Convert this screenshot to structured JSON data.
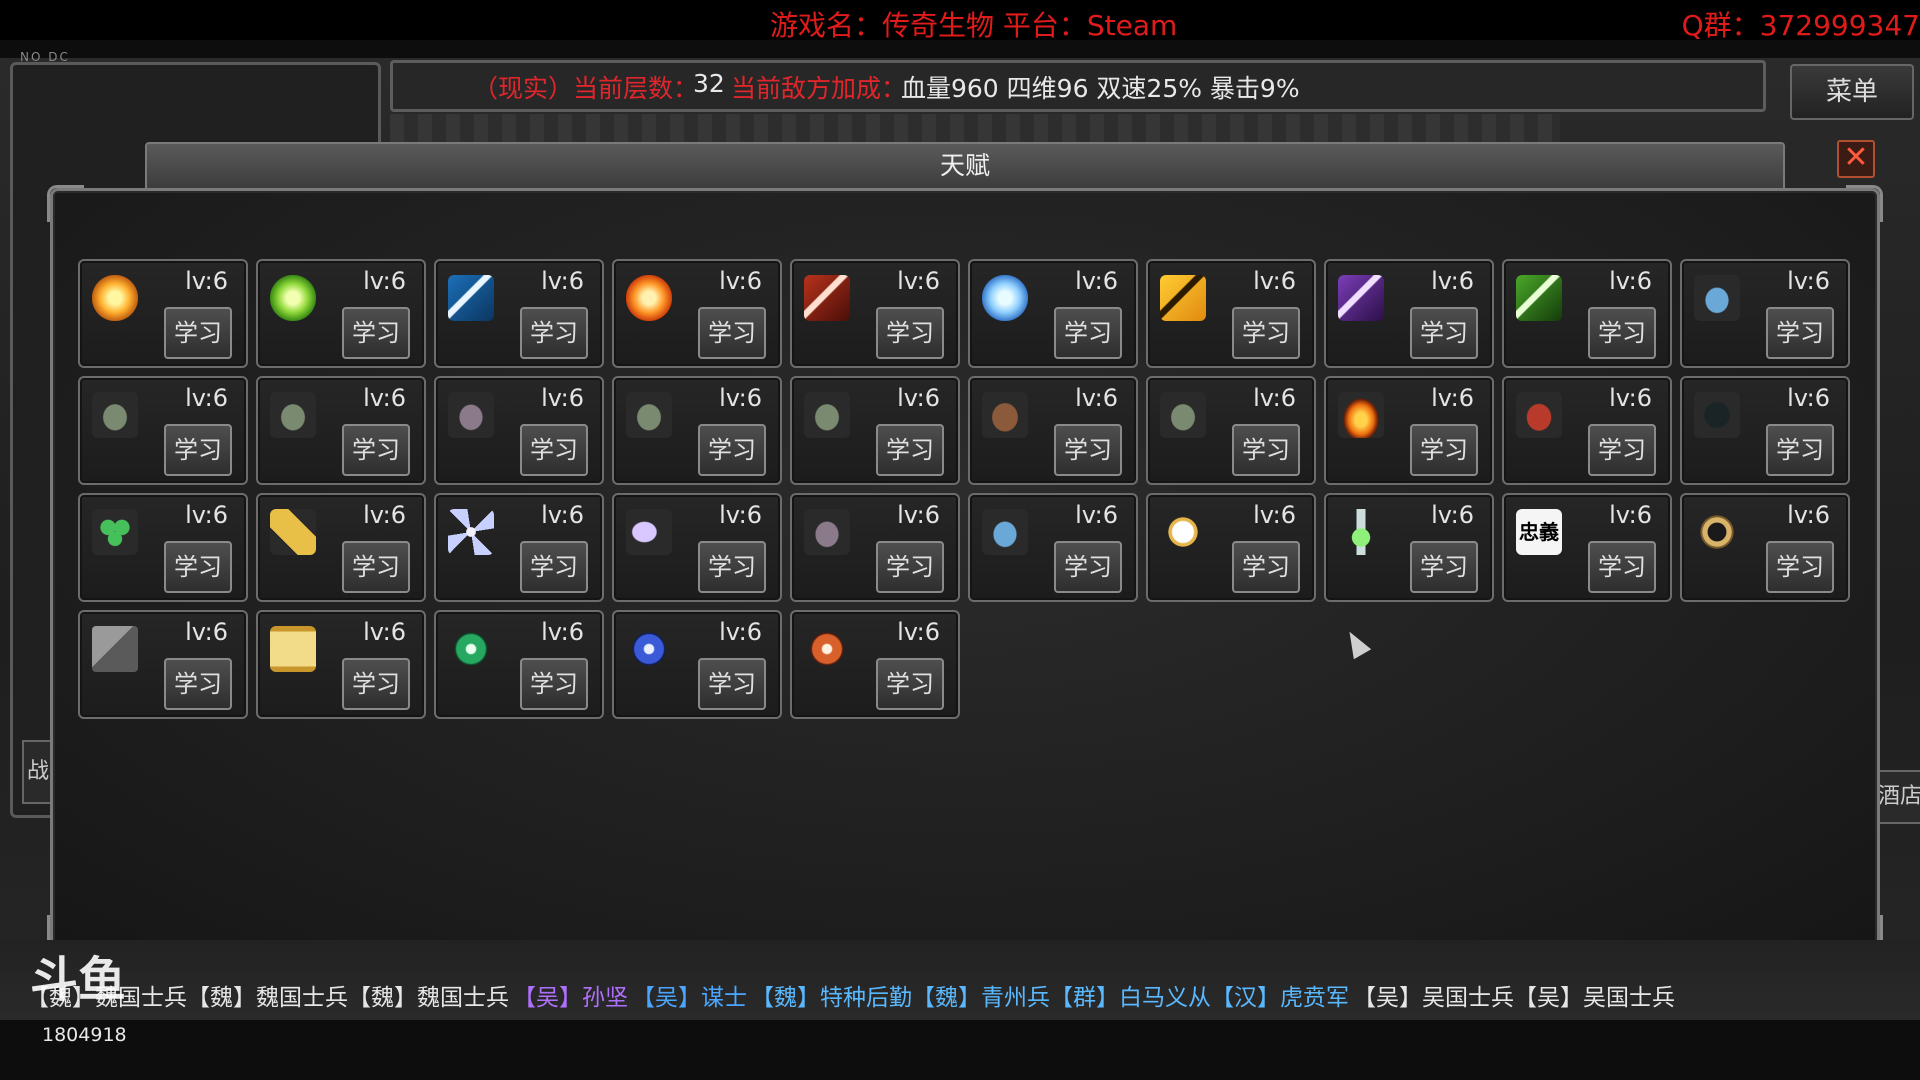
{
  "stream": {
    "game_name": "游戏名：传奇生物 平台：Steam",
    "qq_group": "Q群：372999347",
    "overlay_tag": "NO DC",
    "room_id": "1804918",
    "watermark": "斗鱼"
  },
  "info_bar": {
    "prefix": "（现实）当前层数：",
    "floor": "32",
    "enemy_label": "当前敌方加成：",
    "bonus": "血量960  四维96  双速25%  暴击9%"
  },
  "menu_label": "菜单",
  "side_left": "战",
  "side_right": "酒店",
  "dialog": {
    "title": "天赋",
    "close_glyph": "✕"
  },
  "talents": [
    {
      "icon": "orb-gold-icon",
      "cls": "ic-orb-gold",
      "level": "lv:6",
      "button": "学习"
    },
    {
      "icon": "orb-green-icon",
      "cls": "ic-orb-green",
      "level": "lv:6",
      "button": "学习"
    },
    {
      "icon": "blue-sword-icon",
      "cls": "ic-sword blue",
      "level": "lv:6",
      "button": "学习"
    },
    {
      "icon": "orb-orange-icon",
      "cls": "ic-orb-orange",
      "level": "lv:6",
      "button": "学习"
    },
    {
      "icon": "red-sword-icon",
      "cls": "ic-sword red",
      "level": "lv:6",
      "button": "学习"
    },
    {
      "icon": "orb-blue-icon",
      "cls": "ic-orb-blue",
      "level": "lv:6",
      "button": "学习"
    },
    {
      "icon": "yellow-sword-icon",
      "cls": "ic-sword yellow",
      "level": "lv:6",
      "button": "学习"
    },
    {
      "icon": "purple-sword-icon",
      "cls": "ic-sword purple",
      "level": "lv:6",
      "button": "学习"
    },
    {
      "icon": "green-sword-icon",
      "cls": "ic-sword green",
      "level": "lv:6",
      "button": "学习"
    },
    {
      "icon": "blue-dragon-icon",
      "cls": "ic-ghost-blue",
      "level": "lv:6",
      "button": "学习"
    },
    {
      "icon": "hooded-elder-icon",
      "cls": "ic-creature",
      "level": "lv:6",
      "button": "学习"
    },
    {
      "icon": "hooded-archer-icon",
      "cls": "ic-creature",
      "level": "lv:6",
      "button": "学习"
    },
    {
      "icon": "wolf-icon",
      "cls": "ic-ghost-gray",
      "level": "lv:6",
      "button": "学习"
    },
    {
      "icon": "armored-soldier-icon",
      "cls": "ic-creature",
      "level": "lv:6",
      "button": "学习"
    },
    {
      "icon": "zombie-icon",
      "cls": "ic-creature",
      "level": "lv:6",
      "button": "学习"
    },
    {
      "icon": "sprout-creature-icon",
      "cls": "ic-brown",
      "level": "lv:6",
      "button": "学习"
    },
    {
      "icon": "egg-icon",
      "cls": "ic-creature",
      "level": "lv:6",
      "button": "学习"
    },
    {
      "icon": "fire-spirit-icon",
      "cls": "ic-fire",
      "level": "lv:6",
      "button": "学习"
    },
    {
      "icon": "red-imp-icon",
      "cls": "ic-red-imp",
      "level": "lv:6",
      "button": "学习"
    },
    {
      "icon": "dark-mage-icon",
      "cls": "ic-dark",
      "level": "lv:6",
      "button": "学习"
    },
    {
      "icon": "clover-icon",
      "cls": "ic-clover",
      "level": "lv:6",
      "button": "学习"
    },
    {
      "icon": "wheat-icon",
      "cls": "ic-wheat",
      "level": "lv:6",
      "button": "学习"
    },
    {
      "icon": "shuriken-icon",
      "cls": "ic-shuriken",
      "level": "lv:6",
      "button": "学习"
    },
    {
      "icon": "claw-icon",
      "cls": "ic-claw",
      "level": "lv:6",
      "button": "学习"
    },
    {
      "icon": "gray-spirit-icon",
      "cls": "ic-ghost-gray",
      "level": "lv:6",
      "button": "学习"
    },
    {
      "icon": "blue-spirit-icon",
      "cls": "ic-ghost-blue",
      "level": "lv:6",
      "button": "学习"
    },
    {
      "icon": "clock-icon",
      "cls": "ic-clock",
      "level": "lv:6",
      "button": "学习"
    },
    {
      "icon": "potion-icon",
      "cls": "ic-potion",
      "level": "lv:6",
      "button": "学习"
    },
    {
      "icon": "loyalty-calligraphy-icon",
      "cls": "ic-text",
      "glyph": "忠義",
      "level": "lv:6",
      "button": "学习"
    },
    {
      "icon": "ring-icon",
      "cls": "ic-ring",
      "level": "lv:6",
      "button": "学习"
    },
    {
      "icon": "book-icon",
      "cls": "ic-book",
      "level": "lv:6",
      "button": "学习"
    },
    {
      "icon": "scroll-icon",
      "cls": "ic-scroll",
      "level": "lv:6",
      "button": "学习"
    },
    {
      "icon": "green-seal-icon",
      "cls": "ic-seal-green",
      "level": "lv:6",
      "button": "学习"
    },
    {
      "icon": "blue-seal-icon",
      "cls": "ic-seal-blue",
      "level": "lv:6",
      "button": "学习"
    },
    {
      "icon": "orange-seal-icon",
      "cls": "ic-seal-orange",
      "level": "lv:6",
      "button": "学习"
    }
  ],
  "ticker": [
    {
      "text": "【魏】魏国士兵【魏】魏国士兵【魏】魏国士兵",
      "color": "c-white"
    },
    {
      "text": "【吴】孙坚",
      "color": "c-purple"
    },
    {
      "text": "【吴】谋士",
      "color": "c-blue"
    },
    {
      "text": "【魏】特种后勤【魏】青州兵【群】白马义从【汉】虎贲军",
      "color": "c-cyan"
    },
    {
      "text": "【吴】吴国士兵【吴】吴国士兵",
      "color": "c-white"
    }
  ]
}
